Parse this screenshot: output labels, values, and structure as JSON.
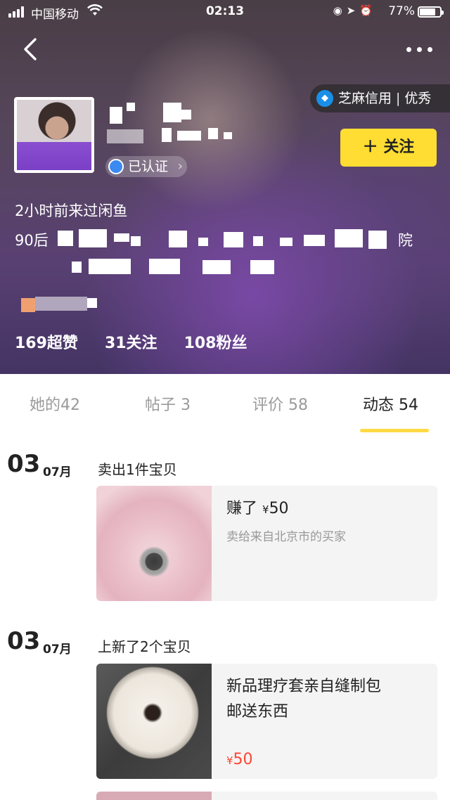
{
  "status_bar": {
    "carrier": "中国移动",
    "time": "02:13",
    "battery_percent": "77%",
    "battery_level": 0.77,
    "icons": [
      "signal-icon",
      "wifi-icon",
      "rotation-lock-icon",
      "location-icon",
      "alarm-icon",
      "battery-icon"
    ]
  },
  "header": {
    "credit_label": "芝麻信用",
    "credit_level": "优秀",
    "verified_label": "已认证",
    "follow_label": "关注",
    "last_seen": "2小时前来过闲鱼",
    "bio_prefix": "90后",
    "bio_suffix": "院",
    "stats": {
      "likes": "169超赞",
      "following": "31关注",
      "fans": "108粉丝"
    }
  },
  "tabs": [
    {
      "label": "她的",
      "count": "42"
    },
    {
      "label": "帖子",
      "count": "3"
    },
    {
      "label": "评价",
      "count": "58"
    },
    {
      "label": "动态",
      "count": "54",
      "active": true
    }
  ],
  "feed": [
    {
      "day": "03",
      "month": "07月",
      "title": "卖出1件宝贝",
      "card": {
        "main_prefix": "赚了",
        "currency": "¥",
        "amount": "50",
        "sub": "卖给来自北京市的买家"
      }
    },
    {
      "day": "03",
      "month": "07月",
      "title": "上新了2个宝贝",
      "card": {
        "line1": "新品理疗套亲自缝制包",
        "line2": "邮送东西",
        "currency": "¥",
        "amount": "50"
      }
    }
  ]
}
